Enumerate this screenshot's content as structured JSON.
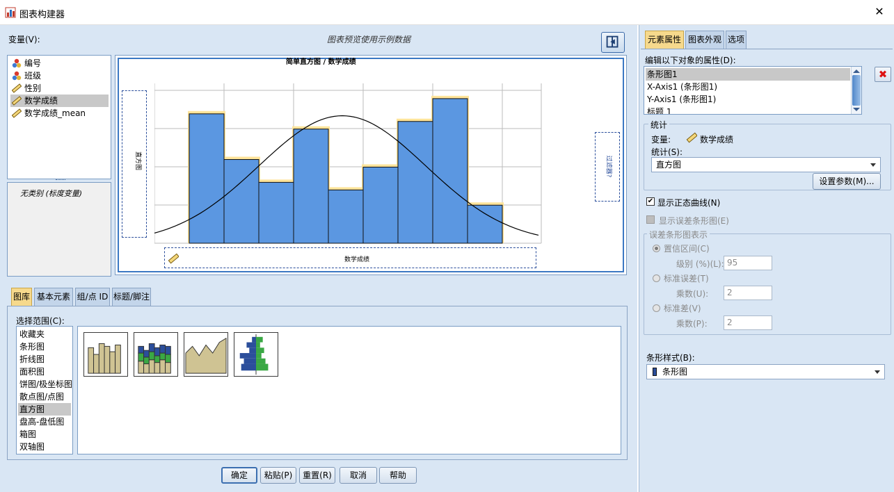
{
  "window": {
    "title": "图表构建器"
  },
  "left": {
    "variables_label": "变量(V):",
    "preview_note": "图表预览使用示例数据",
    "variables": [
      {
        "label": "编号",
        "icon": "nominal-icon"
      },
      {
        "label": "班级",
        "icon": "nominal-icon"
      },
      {
        "label": "性别",
        "icon": "scale-ruler-icon"
      },
      {
        "label": "数学成绩",
        "icon": "scale-ruler-icon",
        "selected": true
      },
      {
        "label": "数学成绩_mean",
        "icon": "scale-ruler-icon"
      }
    ],
    "category_note": "无类别 (标度变量)",
    "canvas": {
      "title": "简单直方图 / 数学成绩",
      "y_dropzone": "直方图",
      "x_dropzone": "数学成绩",
      "right_dropzone": "过滤器?"
    }
  },
  "chart_data": {
    "type": "bar",
    "title": "简单直方图 / 数学成绩",
    "xlabel": "数学成绩",
    "ylabel": "直方图",
    "values": [
      3.4,
      2.2,
      1.6,
      3.0,
      1.4,
      2.0,
      3.2,
      3.8,
      1.0
    ],
    "ylim": [
      0,
      4.2
    ],
    "normal_curve": true,
    "bar_color": "#5b97e1",
    "outline_color": "#ffe49a"
  },
  "bottom_tabs": [
    "图库",
    "基本元素",
    "组/点 ID",
    "标题/脚注"
  ],
  "gallery": {
    "choose_label": "选择范围(C):",
    "items": [
      "收藏夹",
      "条形图",
      "折线图",
      "面积图",
      "饼图/极坐标图",
      "散点图/点图",
      "直方图",
      "盘高-盘低图",
      "箱图",
      "双轴图"
    ],
    "selected": "直方图",
    "thumbnails": [
      "simple-histogram-thumb",
      "stacked-histogram-thumb",
      "frequency-polygon-thumb",
      "population-pyramid-thumb"
    ]
  },
  "buttons": {
    "ok": "确定",
    "paste": "粘贴(P)",
    "reset": "重置(R)",
    "cancel": "取消",
    "help": "帮助"
  },
  "right": {
    "tabs": [
      "元素属性",
      "图表外观",
      "选项"
    ],
    "edit_label": "编辑以下对象的属性(D):",
    "objects": [
      "条形图1",
      "X-Axis1 (条形图1)",
      "Y-Axis1 (条形图1)",
      "标题 1"
    ],
    "stats_group": "统计",
    "variable_label": "变量:",
    "variable_value": "数学成绩",
    "stat_label": "统计(S):",
    "stat_value": "直方图",
    "set_params": "设置参数(M)...",
    "show_normal": "显示正态曲线(N)",
    "show_error": "显示误差条形图(E)",
    "error_group": "误差条形图表示",
    "ci_label": "置信区间(C)",
    "level_label": "级别 (%)(L):",
    "level_value": "95",
    "se_label": "标准误差(T)",
    "se_mult_label": "乘数(U):",
    "se_mult_value": "2",
    "sd_label": "标准差(V)",
    "sd_mult_label": "乘数(P):",
    "sd_mult_value": "2",
    "bar_style_label": "条形样式(B):",
    "bar_style_value": "条形图"
  }
}
